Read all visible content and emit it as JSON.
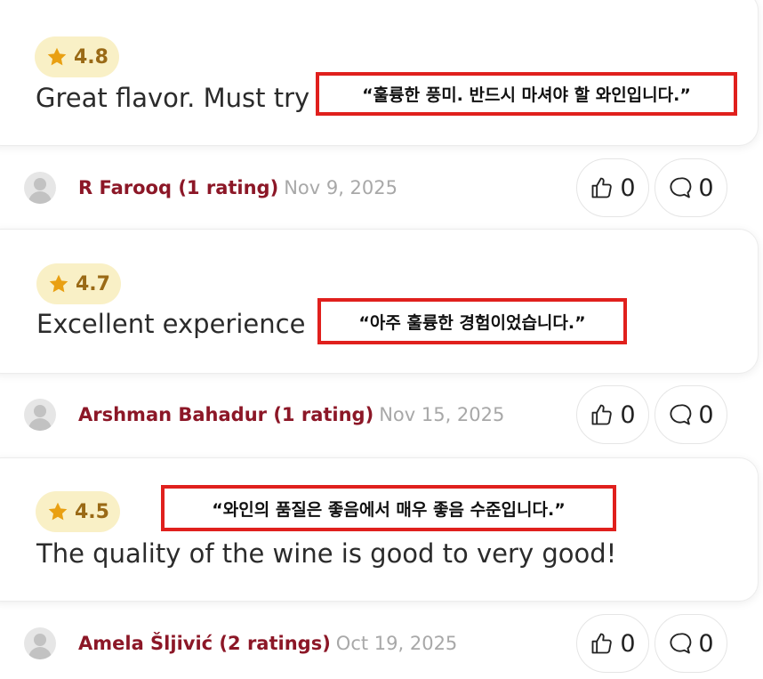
{
  "reviews": [
    {
      "rating": "4.8",
      "text": "Great flavor. Must try",
      "annotation": "“훌륭한 풍미. 반드시 마셔야 할 와인입니다.”"
    },
    {
      "rating": "4.7",
      "text": "Excellent experience",
      "annotation": "“아주 훌륭한 경험이었습니다.”",
      "author": "R Farooq (1 rating)",
      "date": "Nov 9, 2025",
      "likes": "0",
      "comments": "0"
    },
    {
      "rating": "4.5",
      "text": "The quality of the wine is good to very good!",
      "annotation": "“와인의 품질은 좋음에서 매우 좋음 수준입니다.”",
      "author": "Arshman Bahadur (1 rating)",
      "date": "Nov 15, 2025",
      "likes": "0",
      "comments": "0"
    },
    {
      "author": "Amela Šljivić (2 ratings)",
      "date": "Oct 19, 2025",
      "likes": "0",
      "comments": "0"
    }
  ],
  "colors": {
    "author": "#8c1727",
    "star": "#e9a012",
    "pill": "#f9f0c6",
    "annotation_border": "#e0201d"
  },
  "icons": {
    "star": "star-icon",
    "like": "thumbs-up-icon",
    "comment": "comment-bubble-icon",
    "avatar": "user-avatar-placeholder"
  }
}
